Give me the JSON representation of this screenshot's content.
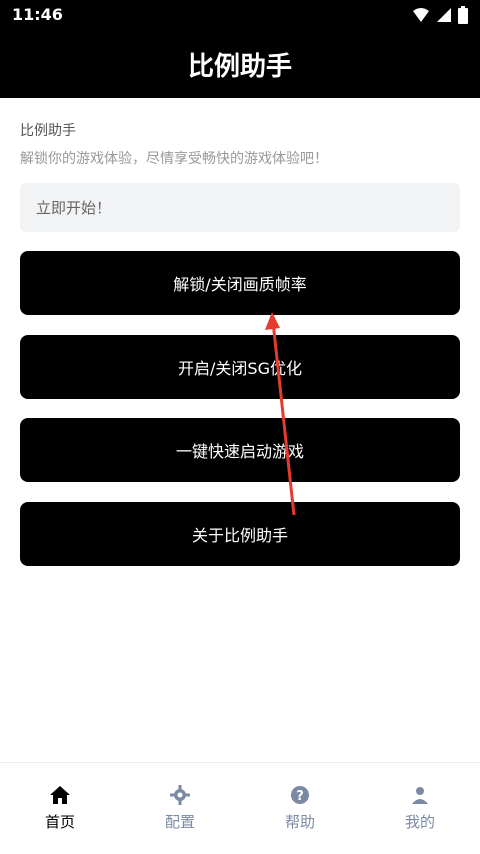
{
  "status_bar": {
    "time": "11:46"
  },
  "header": {
    "title": "比例助手"
  },
  "intro": {
    "name": "比例助手",
    "description": "解锁你的游戏体验，尽情享受畅快的游戏体验吧！"
  },
  "start_field": {
    "text": "立即开始！"
  },
  "buttons": [
    {
      "label": "解锁/关闭画质帧率"
    },
    {
      "label": "开启/关闭SG优化"
    },
    {
      "label": "一键快速启动游戏"
    },
    {
      "label": "关于比例助手"
    }
  ],
  "tabs": [
    {
      "label": "首页",
      "icon": "home-icon",
      "active": true
    },
    {
      "label": "配置",
      "icon": "gear-icon",
      "active": false
    },
    {
      "label": "帮助",
      "icon": "help-icon",
      "active": false
    },
    {
      "label": "我的",
      "icon": "user-icon",
      "active": false
    }
  ],
  "colors": {
    "header_bg": "#000000",
    "button_bg": "#000000",
    "arrow": "#e63b2e",
    "tab_inactive": "#7b8aa3"
  }
}
